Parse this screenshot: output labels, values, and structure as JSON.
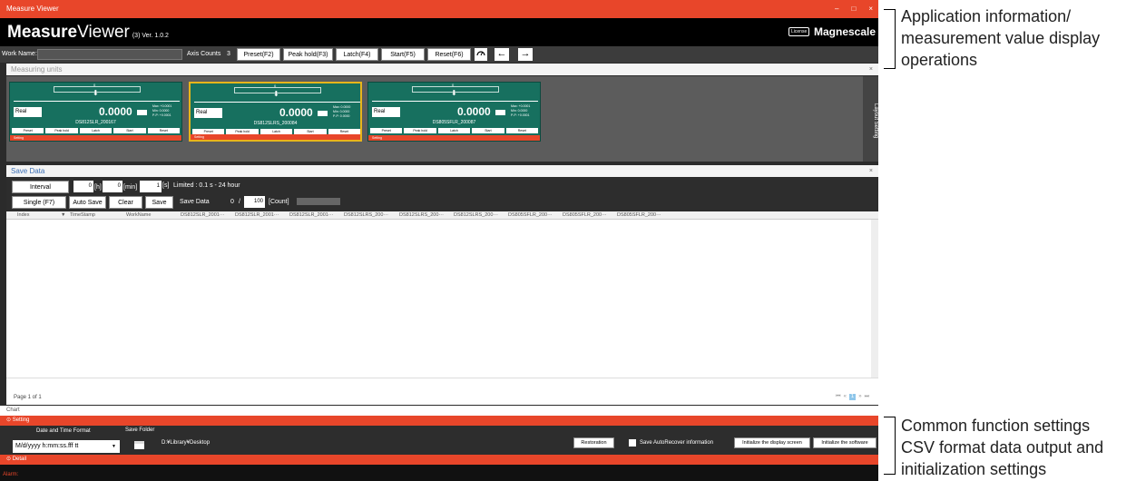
{
  "window": {
    "title": "Measure Viewer",
    "controls": [
      "–",
      "□",
      "×"
    ]
  },
  "header": {
    "logo_bold": "Measure",
    "logo_rest": "Viewer",
    "version": "(3) Ver. 1.0.2",
    "license": "License",
    "brand": "Magnescale"
  },
  "toolbar": {
    "work_name_label": "Work Name:",
    "axis_counts_label": "Axis Counts",
    "axis_counts_value": "3",
    "preset": "Preset(F2)",
    "peak_hold": "Peak hold(F3)",
    "latch": "Latch(F4)",
    "start": "Start(F5)",
    "reset": "Reset(F6)",
    "gauge_icon": "gauge-icon",
    "back": "←",
    "forward": "→"
  },
  "measuring_units": {
    "title": "Measuring units",
    "close": "×",
    "layout_setting": "Layout Setting",
    "units": [
      {
        "scale_zero": "0",
        "mode": "Real",
        "value": "0.0000",
        "stats": [
          "Max:  +0.0001",
          "Min:   0.0000",
          "P-P:  +0.0001"
        ],
        "name": "DS812SLR_200167",
        "buttons": [
          "Preset",
          "Peak hold",
          "Latch",
          "Start",
          "Reset"
        ],
        "setting": "Setting"
      },
      {
        "scale_zero": "0",
        "mode": "Real",
        "value": "0.0000",
        "stats": [
          "Max:   0.0000",
          "Min:   0.0000",
          "P-P:   0.0000"
        ],
        "name": "DS812SLRS_200084",
        "buttons": [
          "Preset",
          "Peak hold",
          "Latch",
          "Start",
          "Reset"
        ],
        "setting": "Setting"
      },
      {
        "scale_zero": "0",
        "mode": "Real",
        "value": "0.0000",
        "stats": [
          "Max:  +0.0001",
          "Min:   0.0000",
          "P-P:  +0.0001"
        ],
        "name": "DS805SFLR_200087",
        "buttons": [
          "Preset",
          "Peak hold",
          "Latch",
          "Start",
          "Reset"
        ],
        "setting": "Setting"
      }
    ]
  },
  "save_data": {
    "title": "Save Data",
    "close": "×",
    "interval": "Interval",
    "h_value": "0",
    "h_unit": "[h]",
    "min_value": "0",
    "min_unit": "[min]",
    "s_value": "1",
    "s_unit": "[s]",
    "limited": "Limited : 0.1 s - 24 hour",
    "single": "Single (F7)",
    "auto_save": "Auto Save",
    "clear": "Clear",
    "save": "Save",
    "save_data_label": "Save Data",
    "count_current": "0",
    "count_sep": "/",
    "count_max": "100",
    "count_unit": "[Count]",
    "columns": [
      "Index",
      "TimeStamp",
      "WorkName",
      "DS812SLR_2001···",
      "DS812SLR_2001···",
      "DS812SLR_2001···",
      "DS812SLRS_200···",
      "DS812SLRS_200···",
      "DS812SLRS_200···",
      "DS805SFLR_200···",
      "DS805SFLR_200···",
      "DS805SFLR_200···"
    ],
    "page": "Page 1 of 1",
    "pager": [
      "⏮",
      "«",
      "1",
      "»",
      "⏭"
    ]
  },
  "chart_label": "Chart",
  "setting": {
    "title": "Setting",
    "date_format_label": "Date and Time Format",
    "date_format_value": "M/d/yyyy h:mm:ss.fff tt",
    "save_folder_label": "Save Folder",
    "save_folder_path": "D:¥Library¥Desktop",
    "restoration": "Restoration",
    "auto_recover": "Save AutoRecover information",
    "init_display": "Initialize the display screen",
    "init_software": "Initialize the software"
  },
  "detail": "Detail",
  "alarm": "Alarm:",
  "annotations": [
    "Application information/",
    "measurement value display",
    "operations",
    "Common function settings",
    "CSV format data output and",
    "initialization settings"
  ]
}
